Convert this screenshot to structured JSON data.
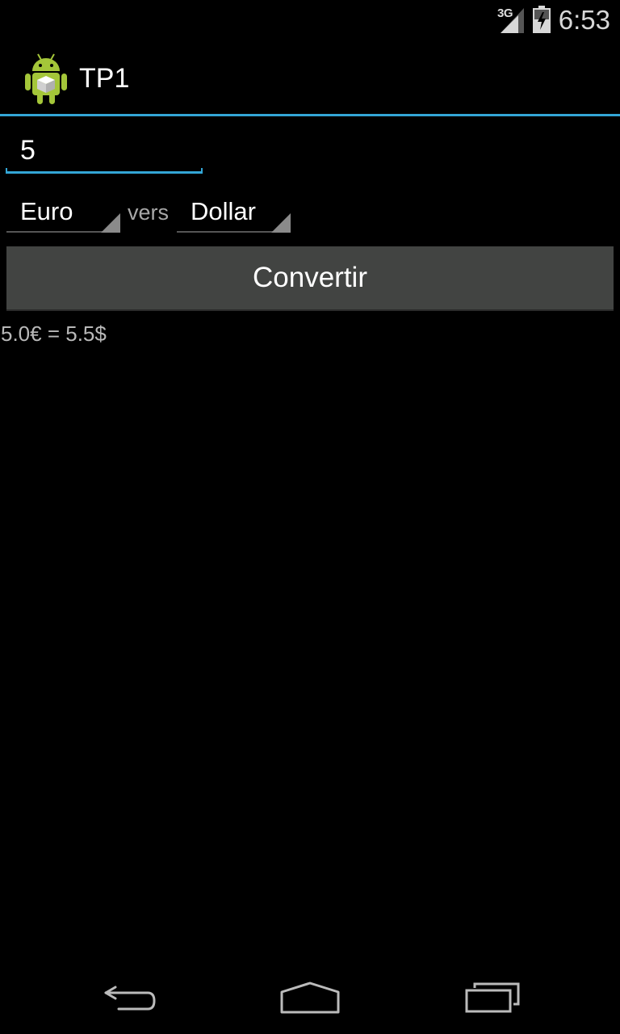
{
  "status_bar": {
    "network_type": "3G",
    "time": "6:53",
    "icons": [
      "signal-icon",
      "battery-icon"
    ]
  },
  "action_bar": {
    "title": "TP1",
    "icon": "android-app-icon",
    "accent_color": "#33a6d6"
  },
  "converter": {
    "amount_value": "5",
    "from_currency": "Euro",
    "separator_label": "vers",
    "to_currency": "Dollar",
    "convert_button_label": "Convertir",
    "result": "5.0€ = 5.5$"
  },
  "nav_bar": {
    "buttons": [
      "back-icon",
      "home-icon",
      "recent-apps-icon"
    ]
  }
}
